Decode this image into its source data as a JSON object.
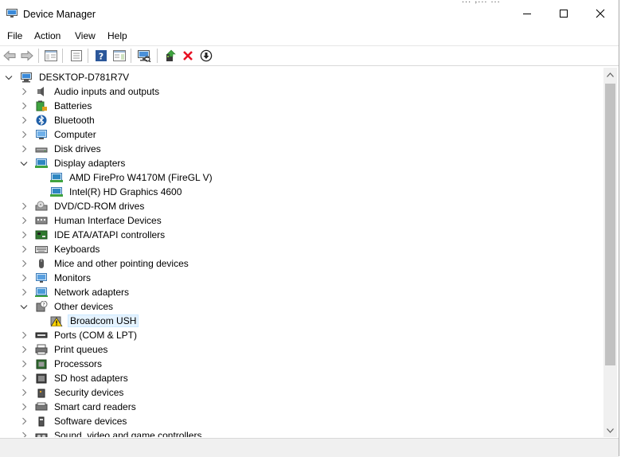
{
  "window": {
    "title": "Device Manager"
  },
  "background_text": "... ,... ...",
  "menu": [
    {
      "label": "File"
    },
    {
      "label": "Action"
    },
    {
      "label": "View"
    },
    {
      "label": "Help"
    }
  ],
  "toolbar": [
    {
      "icon": "back-arrow-icon"
    },
    {
      "icon": "forward-arrow-icon"
    },
    {
      "icon": "show-hide-console-tree-icon"
    },
    {
      "icon": "properties-icon"
    },
    {
      "icon": "help-icon"
    },
    {
      "icon": "action-pane-icon"
    },
    {
      "icon": "scan-hardware-changes-icon"
    },
    {
      "icon": "update-driver-icon"
    },
    {
      "icon": "uninstall-device-icon"
    },
    {
      "icon": "disable-device-icon"
    }
  ],
  "tree": {
    "root": {
      "label": "DESKTOP-D781R7V",
      "expanded": true
    },
    "items": [
      {
        "label": "Audio inputs and outputs",
        "level": 1,
        "expanded": false,
        "icon": "speaker-icon"
      },
      {
        "label": "Batteries",
        "level": 1,
        "expanded": false,
        "icon": "battery-icon"
      },
      {
        "label": "Bluetooth",
        "level": 1,
        "expanded": false,
        "icon": "bluetooth-icon"
      },
      {
        "label": "Computer",
        "level": 1,
        "expanded": false,
        "icon": "computer-icon"
      },
      {
        "label": "Disk drives",
        "level": 1,
        "expanded": false,
        "icon": "disk-drive-icon"
      },
      {
        "label": "Display adapters",
        "level": 1,
        "expanded": true,
        "icon": "display-adapter-icon"
      },
      {
        "label": "AMD FirePro W4170M (FireGL V)",
        "level": 2,
        "icon": "display-adapter-icon"
      },
      {
        "label": "Intel(R) HD Graphics 4600",
        "level": 2,
        "icon": "display-adapter-icon"
      },
      {
        "label": "DVD/CD-ROM drives",
        "level": 1,
        "expanded": false,
        "icon": "dvd-drive-icon"
      },
      {
        "label": "Human Interface Devices",
        "level": 1,
        "expanded": false,
        "icon": "hid-icon"
      },
      {
        "label": "IDE ATA/ATAPI controllers",
        "level": 1,
        "expanded": false,
        "icon": "ide-controller-icon"
      },
      {
        "label": "Keyboards",
        "level": 1,
        "expanded": false,
        "icon": "keyboard-icon"
      },
      {
        "label": "Mice and other pointing devices",
        "level": 1,
        "expanded": false,
        "icon": "mouse-icon"
      },
      {
        "label": "Monitors",
        "level": 1,
        "expanded": false,
        "icon": "monitor-icon"
      },
      {
        "label": "Network adapters",
        "level": 1,
        "expanded": false,
        "icon": "network-adapter-icon"
      },
      {
        "label": "Other devices",
        "level": 1,
        "expanded": true,
        "icon": "other-devices-icon"
      },
      {
        "label": "Broadcom USH",
        "level": 2,
        "icon": "warning-device-icon",
        "selected": true
      },
      {
        "label": "Ports (COM & LPT)",
        "level": 1,
        "expanded": false,
        "icon": "port-icon"
      },
      {
        "label": "Print queues",
        "level": 1,
        "expanded": false,
        "icon": "printer-icon"
      },
      {
        "label": "Processors",
        "level": 1,
        "expanded": false,
        "icon": "processor-icon"
      },
      {
        "label": "SD host adapters",
        "level": 1,
        "expanded": false,
        "icon": "sd-host-adapter-icon"
      },
      {
        "label": "Security devices",
        "level": 1,
        "expanded": false,
        "icon": "security-device-icon"
      },
      {
        "label": "Smart card readers",
        "level": 1,
        "expanded": false,
        "icon": "smart-card-reader-icon"
      },
      {
        "label": "Software devices",
        "level": 1,
        "expanded": false,
        "icon": "software-device-icon"
      },
      {
        "label": "Sound, video and game controllers",
        "level": 1,
        "expanded": false,
        "icon": "sound-controller-icon"
      }
    ]
  },
  "colors": {
    "selection_bg": "#e5f3ff",
    "selection_border": "#cce8ff",
    "uninstall_red": "#e81123",
    "help_blue": "#2b579a"
  }
}
